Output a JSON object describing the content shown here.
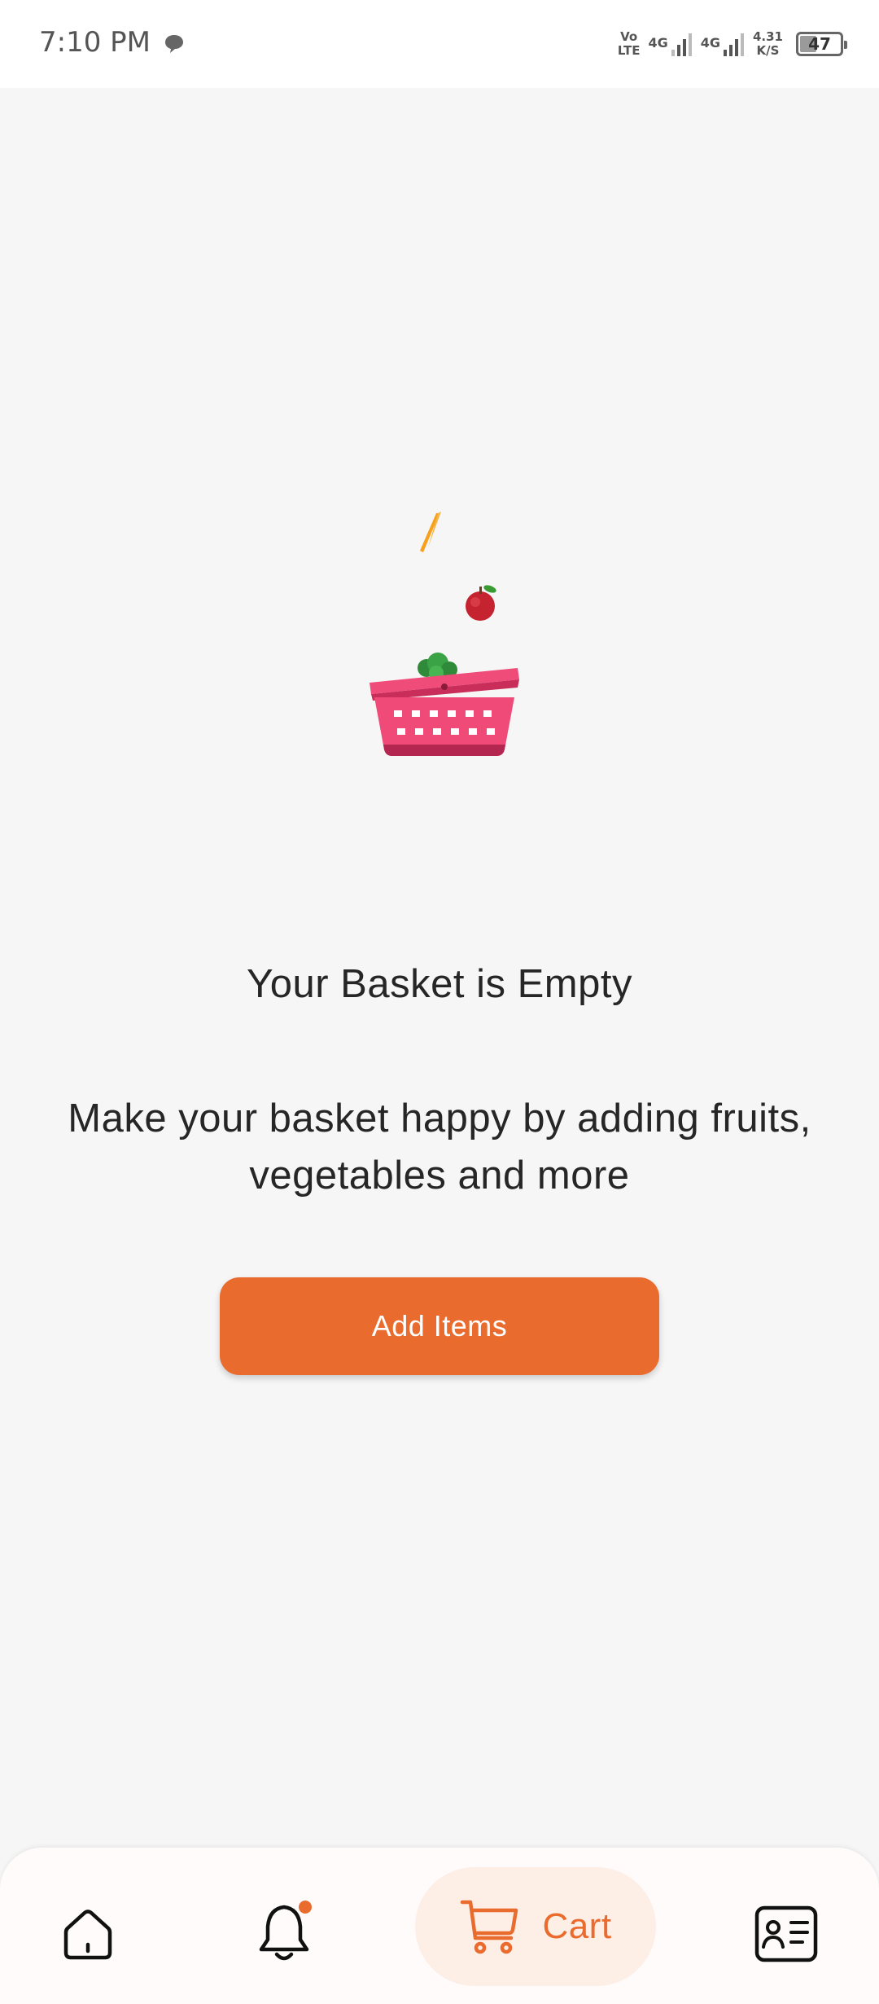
{
  "status_bar": {
    "time": "7:10 PM",
    "volte_top": "Vo",
    "volte_bottom": "LTE",
    "sim1_label": "4G",
    "sim2_label": "4G",
    "speed_value": "4.31",
    "speed_unit": "K/S",
    "battery_level": "47",
    "battery_percent": 47
  },
  "empty_state": {
    "title": "Your Basket is Empty",
    "subtitle": "Make your basket happy by adding fruits, vegetables and more",
    "button_label": "Add Items"
  },
  "bottom_nav": {
    "items": [
      {
        "name": "home",
        "icon": "home-icon"
      },
      {
        "name": "notifications",
        "icon": "bell-icon",
        "has_badge": true
      },
      {
        "name": "cart",
        "icon": "cart-icon",
        "label": "Cart",
        "active": true
      },
      {
        "name": "profile",
        "icon": "id-card-icon"
      }
    ]
  },
  "colors": {
    "accent": "#ea6b2e",
    "accent_soft": "#fdeee6",
    "basket": "#ef4a78",
    "background": "#f6f6f6",
    "text": "#262626"
  }
}
